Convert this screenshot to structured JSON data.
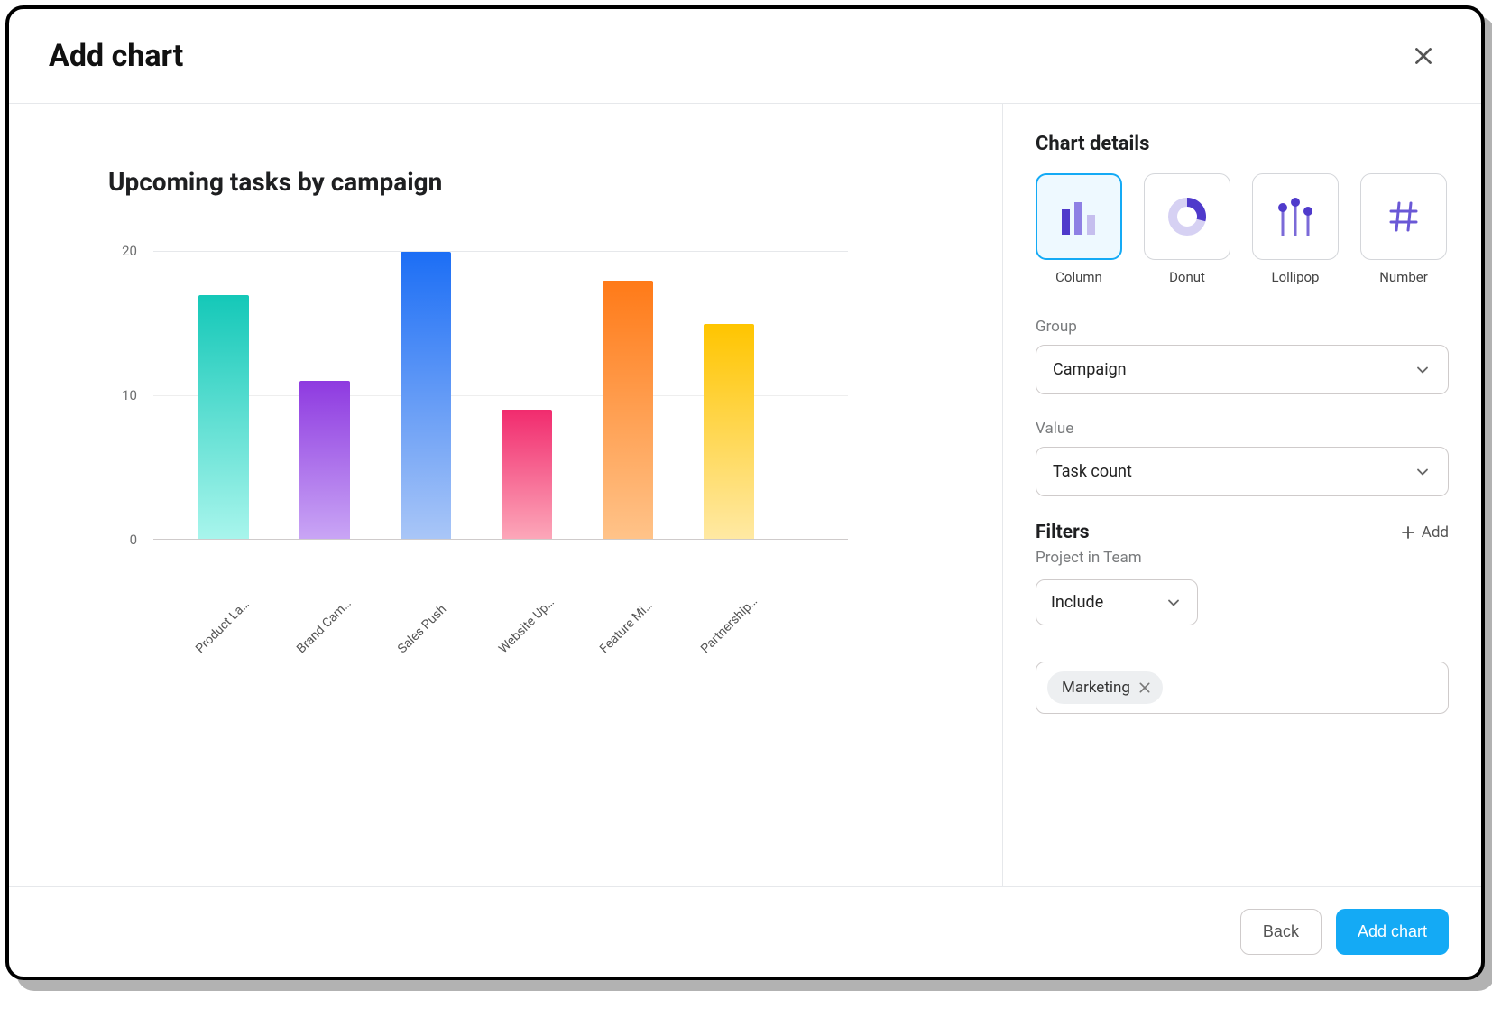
{
  "modal": {
    "title": "Add chart"
  },
  "preview": {
    "title": "Upcoming tasks by campaign"
  },
  "chart_data": {
    "type": "bar",
    "title": "Upcoming tasks by campaign",
    "categories": [
      "Product La…",
      "Brand Cam…",
      "Sales Push",
      "Website Up…",
      "Feature Mi…",
      "Partnership…"
    ],
    "values": [
      17,
      11,
      20,
      9,
      18,
      15
    ],
    "ylabel": "",
    "xlabel": "",
    "ylim": [
      0,
      20
    ],
    "yticks": [
      0,
      10,
      20
    ]
  },
  "details": {
    "heading": "Chart details",
    "types": [
      {
        "id": "column",
        "label": "Column",
        "selected": true
      },
      {
        "id": "donut",
        "label": "Donut",
        "selected": false
      },
      {
        "id": "lollipop",
        "label": "Lollipop",
        "selected": false
      },
      {
        "id": "number",
        "label": "Number",
        "selected": false
      }
    ],
    "group": {
      "label": "Group",
      "value": "Campaign"
    },
    "value": {
      "label": "Value",
      "value": "Task count"
    },
    "filters": {
      "heading": "Filters",
      "add_label": "Add",
      "sublabel": "Project in Team",
      "mode": "Include",
      "tags": [
        "Marketing"
      ]
    }
  },
  "footer": {
    "back_label": "Back",
    "submit_label": "Add chart"
  }
}
